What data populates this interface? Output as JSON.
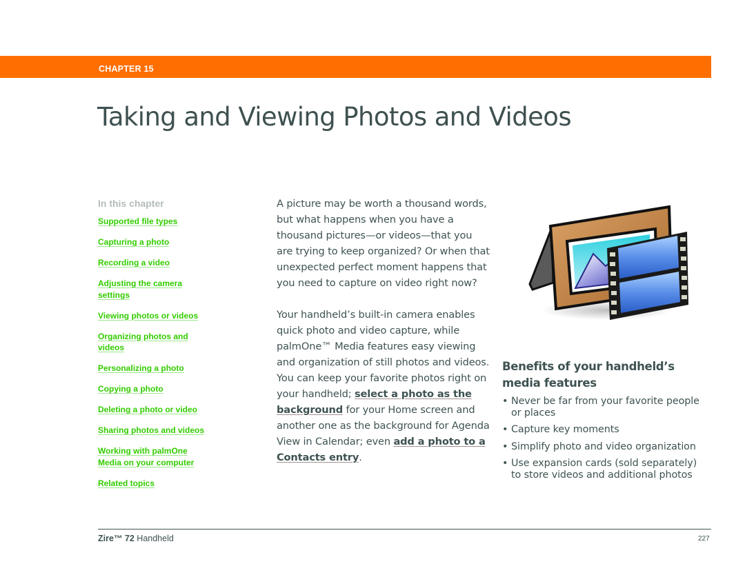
{
  "header": {
    "chapter_label": "CHAPTER 15",
    "accent_color": "#ff6e00"
  },
  "page_title": "Taking and Viewing Photos and Videos",
  "toc": {
    "heading": "In this chapter",
    "link_color": "#33cc00",
    "links": [
      {
        "label": "Supported file types"
      },
      {
        "label": "Capturing a photo"
      },
      {
        "label": "Recording a video"
      },
      {
        "label": "Adjusting the camera\nsettings"
      },
      {
        "label": "Viewing photos or videos"
      },
      {
        "label": "Organizing photos and\nvideos"
      },
      {
        "label": "Personalizing a photo"
      },
      {
        "label": "Copying a photo"
      },
      {
        "label": "Deleting a photo or video"
      },
      {
        "label": "Sharing photos and videos"
      },
      {
        "label": "Working with palmOne\nMedia on your computer"
      },
      {
        "label": "Related topics"
      }
    ]
  },
  "intro": {
    "paragraph1": "A picture may be worth a thousand words, but what happens when you have a thousand pictures—or videos—that you are trying to keep organized? Or when that unexpected perfect moment happens that you need to capture on video right now?",
    "paragraph2_part1": "Your handheld’s built-in camera enables quick photo and video capture, while palmOne™ Media features easy viewing and organization of still photos and videos. You can keep your favorite photos right on your handheld; ",
    "link_select_background": "select a photo as the background",
    "paragraph2_part2": " for your Home screen and another one as the background for Agenda View in Calendar; even ",
    "link_add_contact_photo": "add a photo to a Contacts entry",
    "paragraph2_part3": "."
  },
  "media_image": {
    "icon": "photo-frame-and-film-strip"
  },
  "benefits": {
    "heading": "Benefits of your handheld’s media features",
    "bullet": "•",
    "items": [
      {
        "text": "Never be far from your favorite people or places"
      },
      {
        "text": "Capture key moments"
      },
      {
        "text": "Simplify photo and video organization"
      },
      {
        "text": "Use expansion cards (sold separately) to store videos and additional photos"
      }
    ]
  },
  "footer": {
    "product_bold": "Zire™ 72",
    "product_rest": " Handheld",
    "page_number": "227"
  }
}
